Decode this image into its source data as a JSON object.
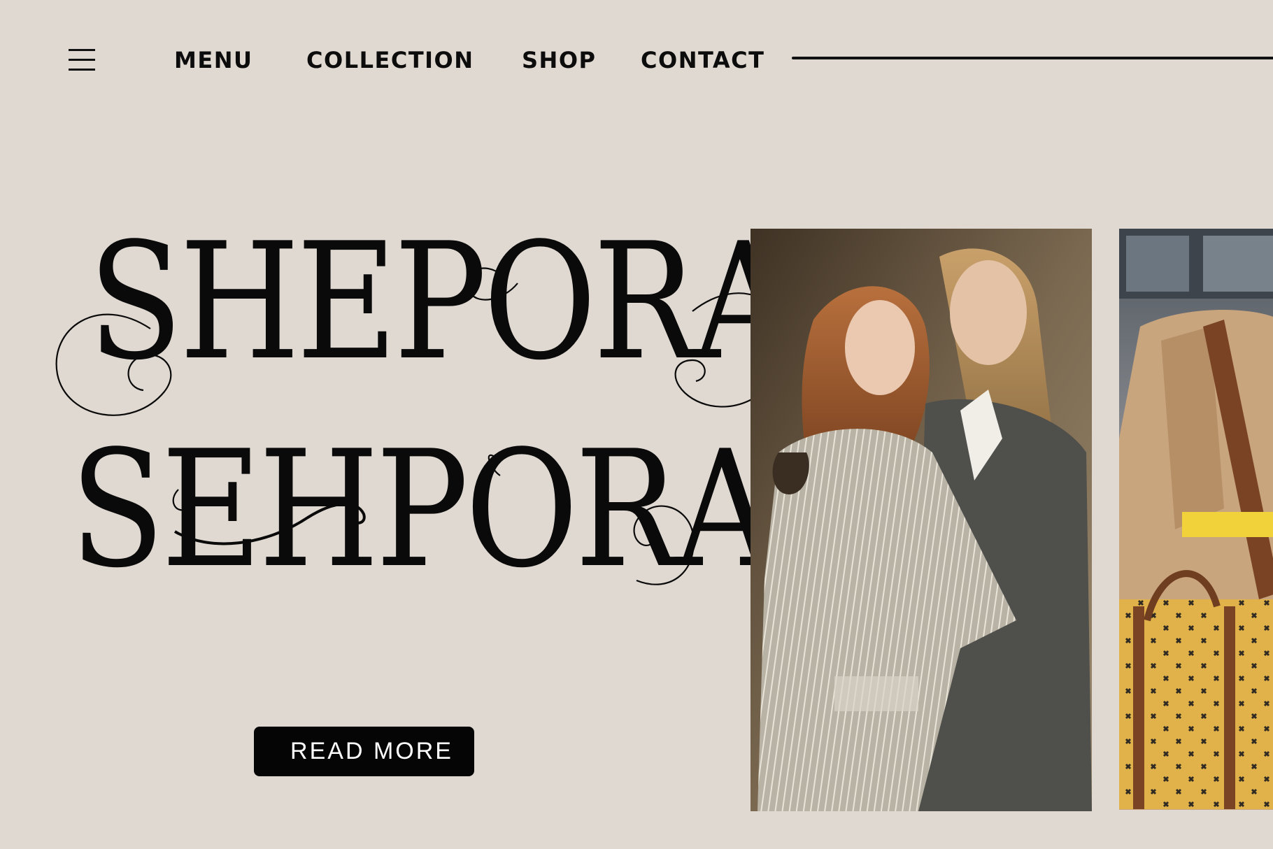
{
  "nav": {
    "menu_icon": "hamburger-icon",
    "items": [
      {
        "label": "MENU"
      },
      {
        "label": "COLLECTION"
      },
      {
        "label": "SHOP"
      },
      {
        "label": "CONTACT"
      }
    ]
  },
  "hero": {
    "line1": "SHEPORA",
    "line2": "SEHPORA",
    "cta_label": "READ MORE"
  },
  "colors": {
    "background": "#e0d9d2",
    "text": "#0a0a0a",
    "button_bg": "#050505",
    "button_text": "#ffffff"
  },
  "images": [
    {
      "name": "two-models-in-blazers-photo"
    },
    {
      "name": "mannequin-with-yellow-bag-photo"
    }
  ]
}
